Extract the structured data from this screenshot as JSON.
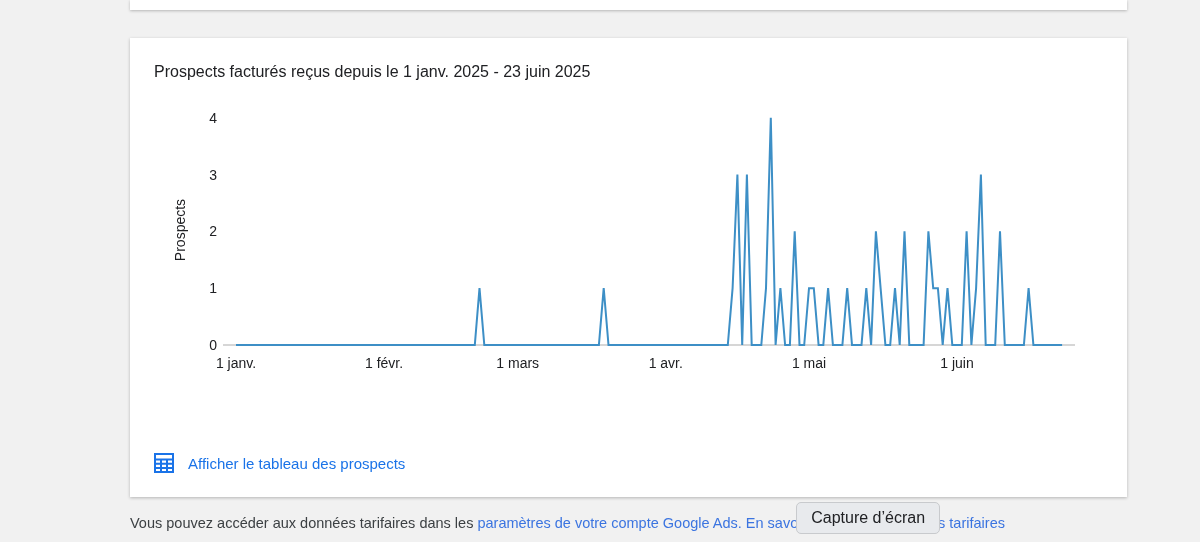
{
  "card": {
    "chart_data": {
      "type": "line",
      "title": "Prospects facturés reçus depuis le 1 janv. 2025 - 23 juin 2025",
      "ylabel": "Prospects",
      "ylim": [
        0,
        4
      ],
      "yticks": [
        0,
        1,
        2,
        3,
        4
      ],
      "categories": [
        "1 janv.",
        null,
        null,
        null,
        null,
        null,
        null,
        null,
        null,
        null,
        null,
        null,
        null,
        null,
        null,
        null,
        null,
        null,
        null,
        null,
        null,
        null,
        null,
        null,
        null,
        null,
        null,
        null,
        null,
        null,
        null,
        "1 févr.",
        null,
        null,
        null,
        null,
        null,
        null,
        null,
        null,
        null,
        null,
        null,
        null,
        null,
        null,
        null,
        null,
        null,
        null,
        null,
        null,
        null,
        null,
        null,
        null,
        null,
        null,
        null,
        "1 mars",
        null,
        null,
        null,
        null,
        null,
        null,
        null,
        null,
        null,
        null,
        null,
        null,
        null,
        null,
        null,
        null,
        null,
        null,
        null,
        null,
        null,
        null,
        null,
        null,
        null,
        null,
        null,
        null,
        null,
        null,
        "1 avr.",
        null,
        null,
        null,
        null,
        null,
        null,
        null,
        null,
        null,
        null,
        null,
        null,
        null,
        null,
        null,
        null,
        null,
        null,
        null,
        null,
        null,
        null,
        null,
        null,
        null,
        null,
        null,
        null,
        null,
        "1 mai",
        null,
        null,
        null,
        null,
        null,
        null,
        null,
        null,
        null,
        null,
        null,
        null,
        null,
        null,
        null,
        null,
        null,
        null,
        null,
        null,
        null,
        null,
        null,
        null,
        null,
        null,
        null,
        null,
        null,
        null,
        "1 juin",
        null,
        null,
        null,
        null,
        null,
        null,
        null,
        null,
        null,
        null,
        null,
        null,
        null,
        null,
        null,
        null,
        null,
        null,
        null,
        null,
        null,
        null
      ],
      "series": [
        {
          "color": "#3d8fc6",
          "values": [
            0,
            0,
            0,
            0,
            0,
            0,
            0,
            0,
            0,
            0,
            0,
            0,
            0,
            0,
            0,
            0,
            0,
            0,
            0,
            0,
            0,
            0,
            0,
            0,
            0,
            0,
            0,
            0,
            0,
            0,
            0,
            0,
            0,
            0,
            0,
            0,
            0,
            0,
            0,
            0,
            0,
            0,
            0,
            0,
            0,
            0,
            0,
            0,
            0,
            0,
            0,
            1,
            0,
            0,
            0,
            0,
            0,
            0,
            0,
            0,
            0,
            0,
            0,
            0,
            0,
            0,
            0,
            0,
            0,
            0,
            0,
            0,
            0,
            0,
            0,
            0,
            0,
            1,
            0,
            0,
            0,
            0,
            0,
            0,
            0,
            0,
            0,
            0,
            0,
            0,
            0,
            0,
            0,
            0,
            0,
            0,
            0,
            0,
            0,
            0,
            0,
            0,
            0,
            0,
            1,
            3,
            0,
            3,
            0,
            0,
            0,
            1,
            4,
            0,
            1,
            0,
            0,
            2,
            0,
            0,
            1,
            1,
            0,
            0,
            1,
            0,
            0,
            0,
            1,
            0,
            0,
            0,
            1,
            0,
            2,
            1,
            0,
            0,
            1,
            0,
            2,
            0,
            0,
            0,
            0,
            2,
            1,
            1,
            0,
            1,
            0,
            0,
            0,
            2,
            0,
            1,
            3,
            0,
            0,
            0,
            2,
            0,
            0,
            0,
            0,
            0,
            1,
            0,
            0,
            0,
            0,
            0,
            0,
            0
          ]
        }
      ]
    },
    "link": {
      "label": "Afficher le tableau des prospects"
    }
  },
  "footer": [
    {
      "kind": "text",
      "text": "Vous pouvez accéder aux données tarifaires dans les "
    },
    {
      "kind": "link",
      "text": "paramètres de votre compte Google Ads. En savo"
    },
    {
      "kind": "tooltip",
      "text": "Capture d’écran"
    },
    {
      "kind": "link",
      "text": "s tarifaires"
    }
  ]
}
